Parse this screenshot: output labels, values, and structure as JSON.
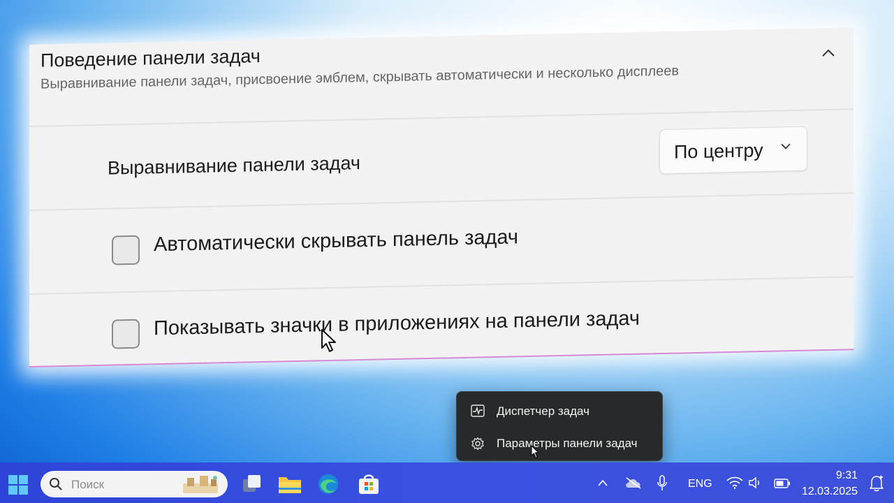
{
  "settings": {
    "section_title": "Поведение панели задач",
    "section_subtitle": "Выравнивание панели задач, присвоение эмблем, скрывать автоматически и несколько дисплеев",
    "alignment": {
      "label": "Выравнивание панели задач",
      "value": "По центру"
    },
    "auto_hide": {
      "label": "Автоматически скрывать панель задач",
      "checked": false
    },
    "show_badges": {
      "label": "Показывать значки в приложениях на панели задач",
      "checked": false
    }
  },
  "context_menu": {
    "items": [
      {
        "label": "Диспетчер задач",
        "icon": "task-manager-icon"
      },
      {
        "label": "Параметры панели задач",
        "icon": "gear-icon"
      }
    ]
  },
  "taskbar": {
    "search_placeholder": "Поиск",
    "pinned": [
      "start-icon",
      "task-view-icon",
      "file-explorer-icon",
      "edge-icon",
      "store-icon"
    ],
    "language": "ENG",
    "time": "9:31",
    "date": "12.03.2025",
    "colors": {
      "taskbar": "#3a52e0",
      "menu_bg": "#262a2a",
      "panel_bg": "#f2f2f2"
    }
  }
}
